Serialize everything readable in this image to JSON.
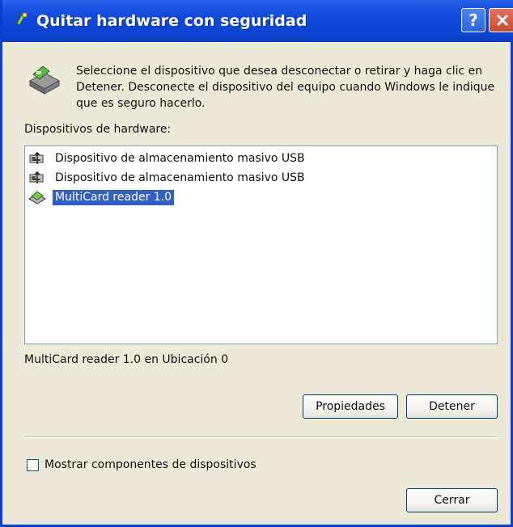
{
  "window": {
    "title": "Quitar hardware con seguridad",
    "help_label": "?"
  },
  "description": "Seleccione el dispositivo que desea desconectar o retirar y haga clic en Detener. Desconecte el dispositivo del equipo cuando Windows le indique que es seguro hacerlo.",
  "devices_label": "Dispositivos de hardware:",
  "devices": [
    {
      "label": "Dispositivo de almacenamiento masivo USB",
      "icon": "usb-icon",
      "selected": false
    },
    {
      "label": "Dispositivo de almacenamiento masivo USB",
      "icon": "usb-icon",
      "selected": false
    },
    {
      "label": "MultiCard reader 1.0",
      "icon": "card-reader-icon",
      "selected": true
    }
  ],
  "status_text": "MultiCard reader 1.0 en Ubicación 0",
  "buttons": {
    "properties": "Propiedades",
    "stop": "Detener",
    "close": "Cerrar"
  },
  "show_components": {
    "label": "Mostrar componentes de dispositivos",
    "checked": false
  },
  "colors": {
    "title_bar": "#0c44d2",
    "selection": "#3161c5",
    "dialog_background": "#ece9d8"
  }
}
